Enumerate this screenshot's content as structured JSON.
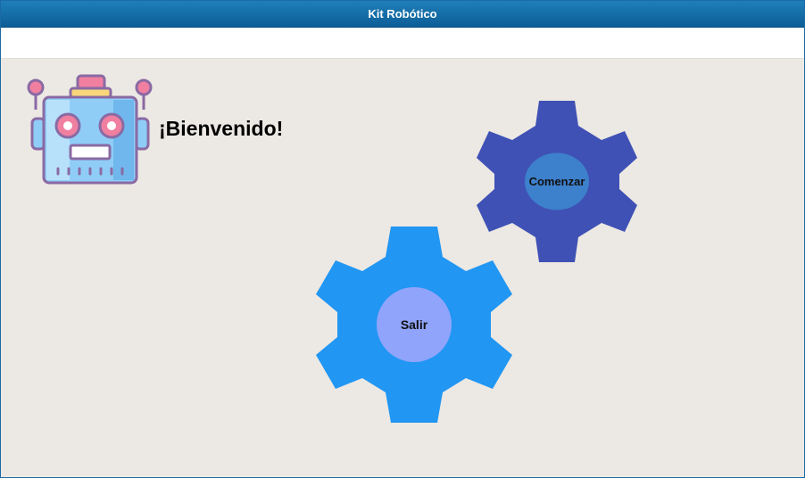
{
  "window": {
    "title": "Kit Robótico"
  },
  "main": {
    "welcome_text": "¡Bienvenido!"
  },
  "buttons": {
    "start": {
      "label": "Comenzar",
      "color": "#3f51b5",
      "hub_color": "#3d80cc"
    },
    "exit": {
      "label": "Salir",
      "color": "#2196f3",
      "hub_color": "#90a4fb"
    }
  },
  "icons": {
    "logo": "robot-icon"
  },
  "colors": {
    "titlebar": "#1671ab",
    "background": "#ece8e3",
    "robot_body": "#8fcdf7",
    "robot_outline": "#8a6aa4",
    "robot_accent": "#f07fa0"
  }
}
